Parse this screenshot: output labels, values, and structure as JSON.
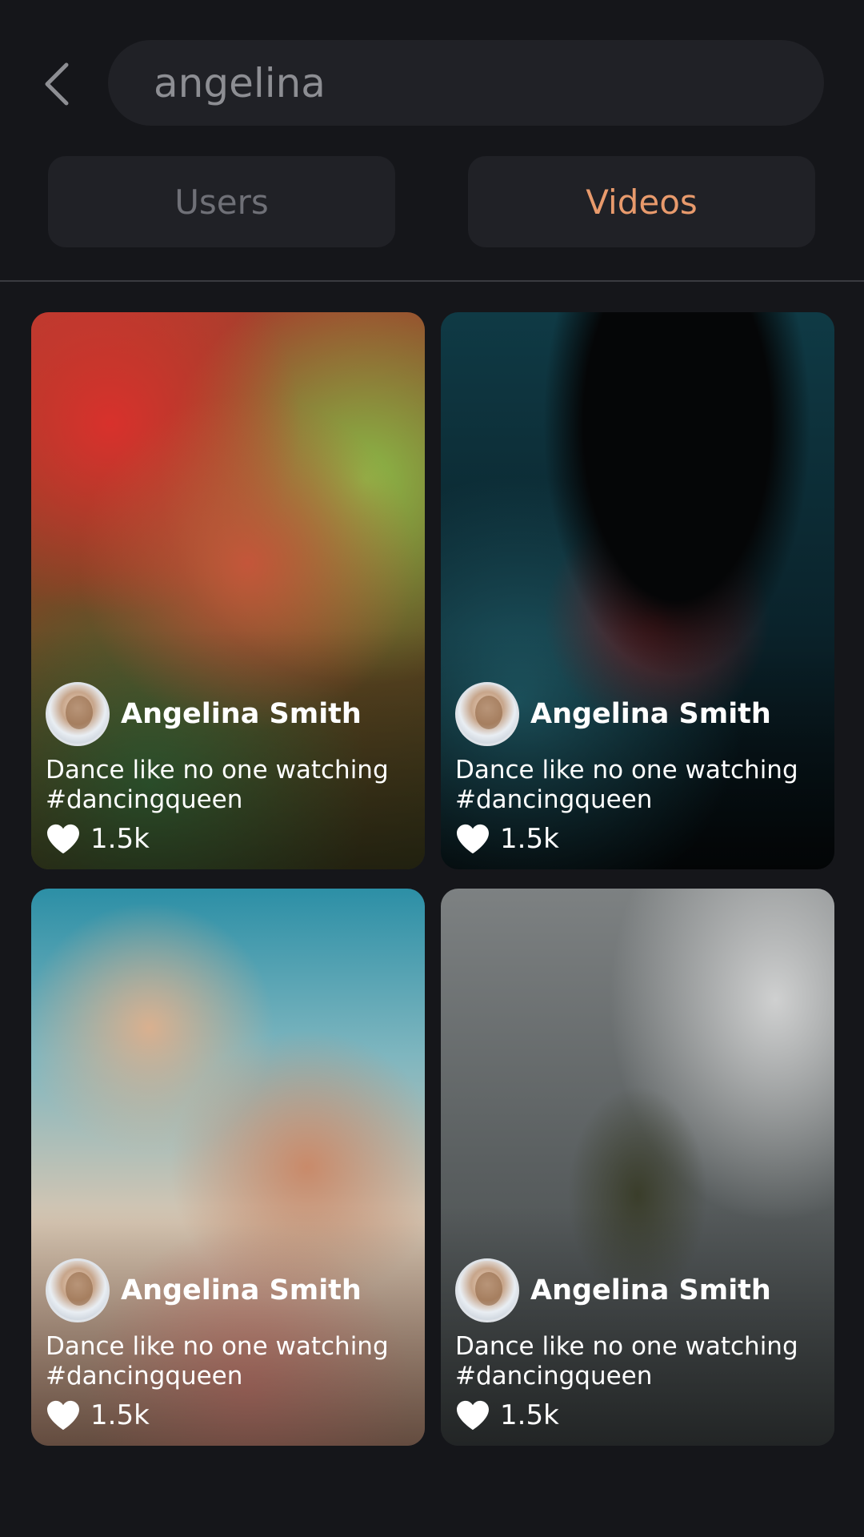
{
  "search": {
    "value": "angelina"
  },
  "tabs": [
    {
      "label": "Users",
      "active": false
    },
    {
      "label": "Videos",
      "active": true
    }
  ],
  "colors": {
    "background": "#15161a",
    "surface": "#202126",
    "accent": "#e89a6c",
    "tab_inactive_text": "#6f7077"
  },
  "icons": {
    "back": "chevron-left-icon",
    "like": "heart-icon"
  },
  "videos": [
    {
      "author": "Angelina Smith",
      "caption": "Dance like no one watching #dancingqueen",
      "likes": "1.5k"
    },
    {
      "author": "Angelina Smith",
      "caption": "Dance like no one watching #dancingqueen",
      "likes": "1.5k"
    },
    {
      "author": "Angelina Smith",
      "caption": "Dance like no one watching #dancingqueen",
      "likes": "1.5k"
    },
    {
      "author": "Angelina Smith",
      "caption": "Dance like no one watching #dancingqueen",
      "likes": "1.5k"
    }
  ]
}
